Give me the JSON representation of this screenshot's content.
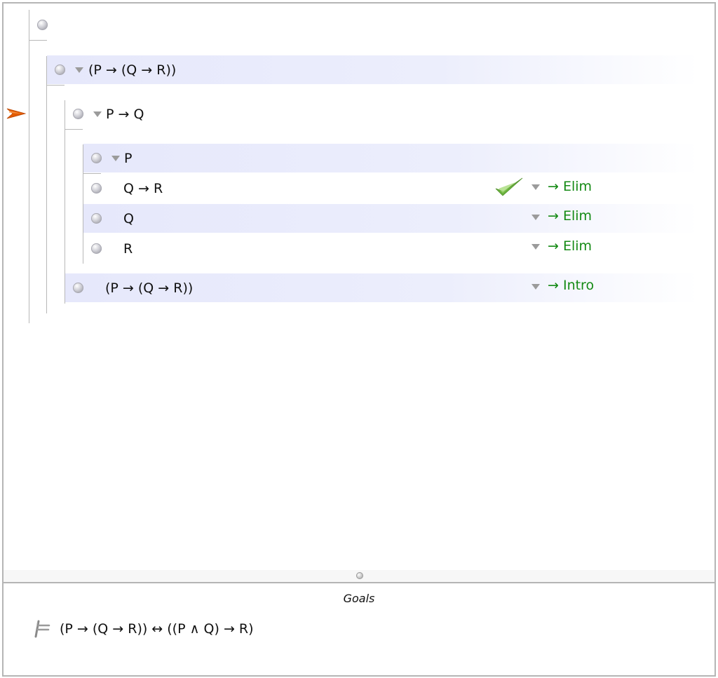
{
  "proof": {
    "rows": [
      {
        "formula": ""
      },
      {
        "formula": "(P → (Q → R))"
      },
      {
        "formula": "P → Q"
      },
      {
        "formula": "P"
      },
      {
        "formula": "Q → R",
        "rule": "→ Elim",
        "checked": true
      },
      {
        "formula": "Q",
        "rule": "→ Elim"
      },
      {
        "formula": "R",
        "rule": "→ Elim"
      },
      {
        "formula": "(P → (Q → R))",
        "rule": "→ Intro"
      }
    ]
  },
  "goals": {
    "title": "Goals",
    "formula": "(P → (Q → R)) ↔ ((P ∧ Q) → R)",
    "icon": "turnstile-icon"
  },
  "colors": {
    "rule_text": "#148a14",
    "row_band": "#e6e8fb",
    "cursor": "#e05a00",
    "check": "#5fa82f"
  }
}
